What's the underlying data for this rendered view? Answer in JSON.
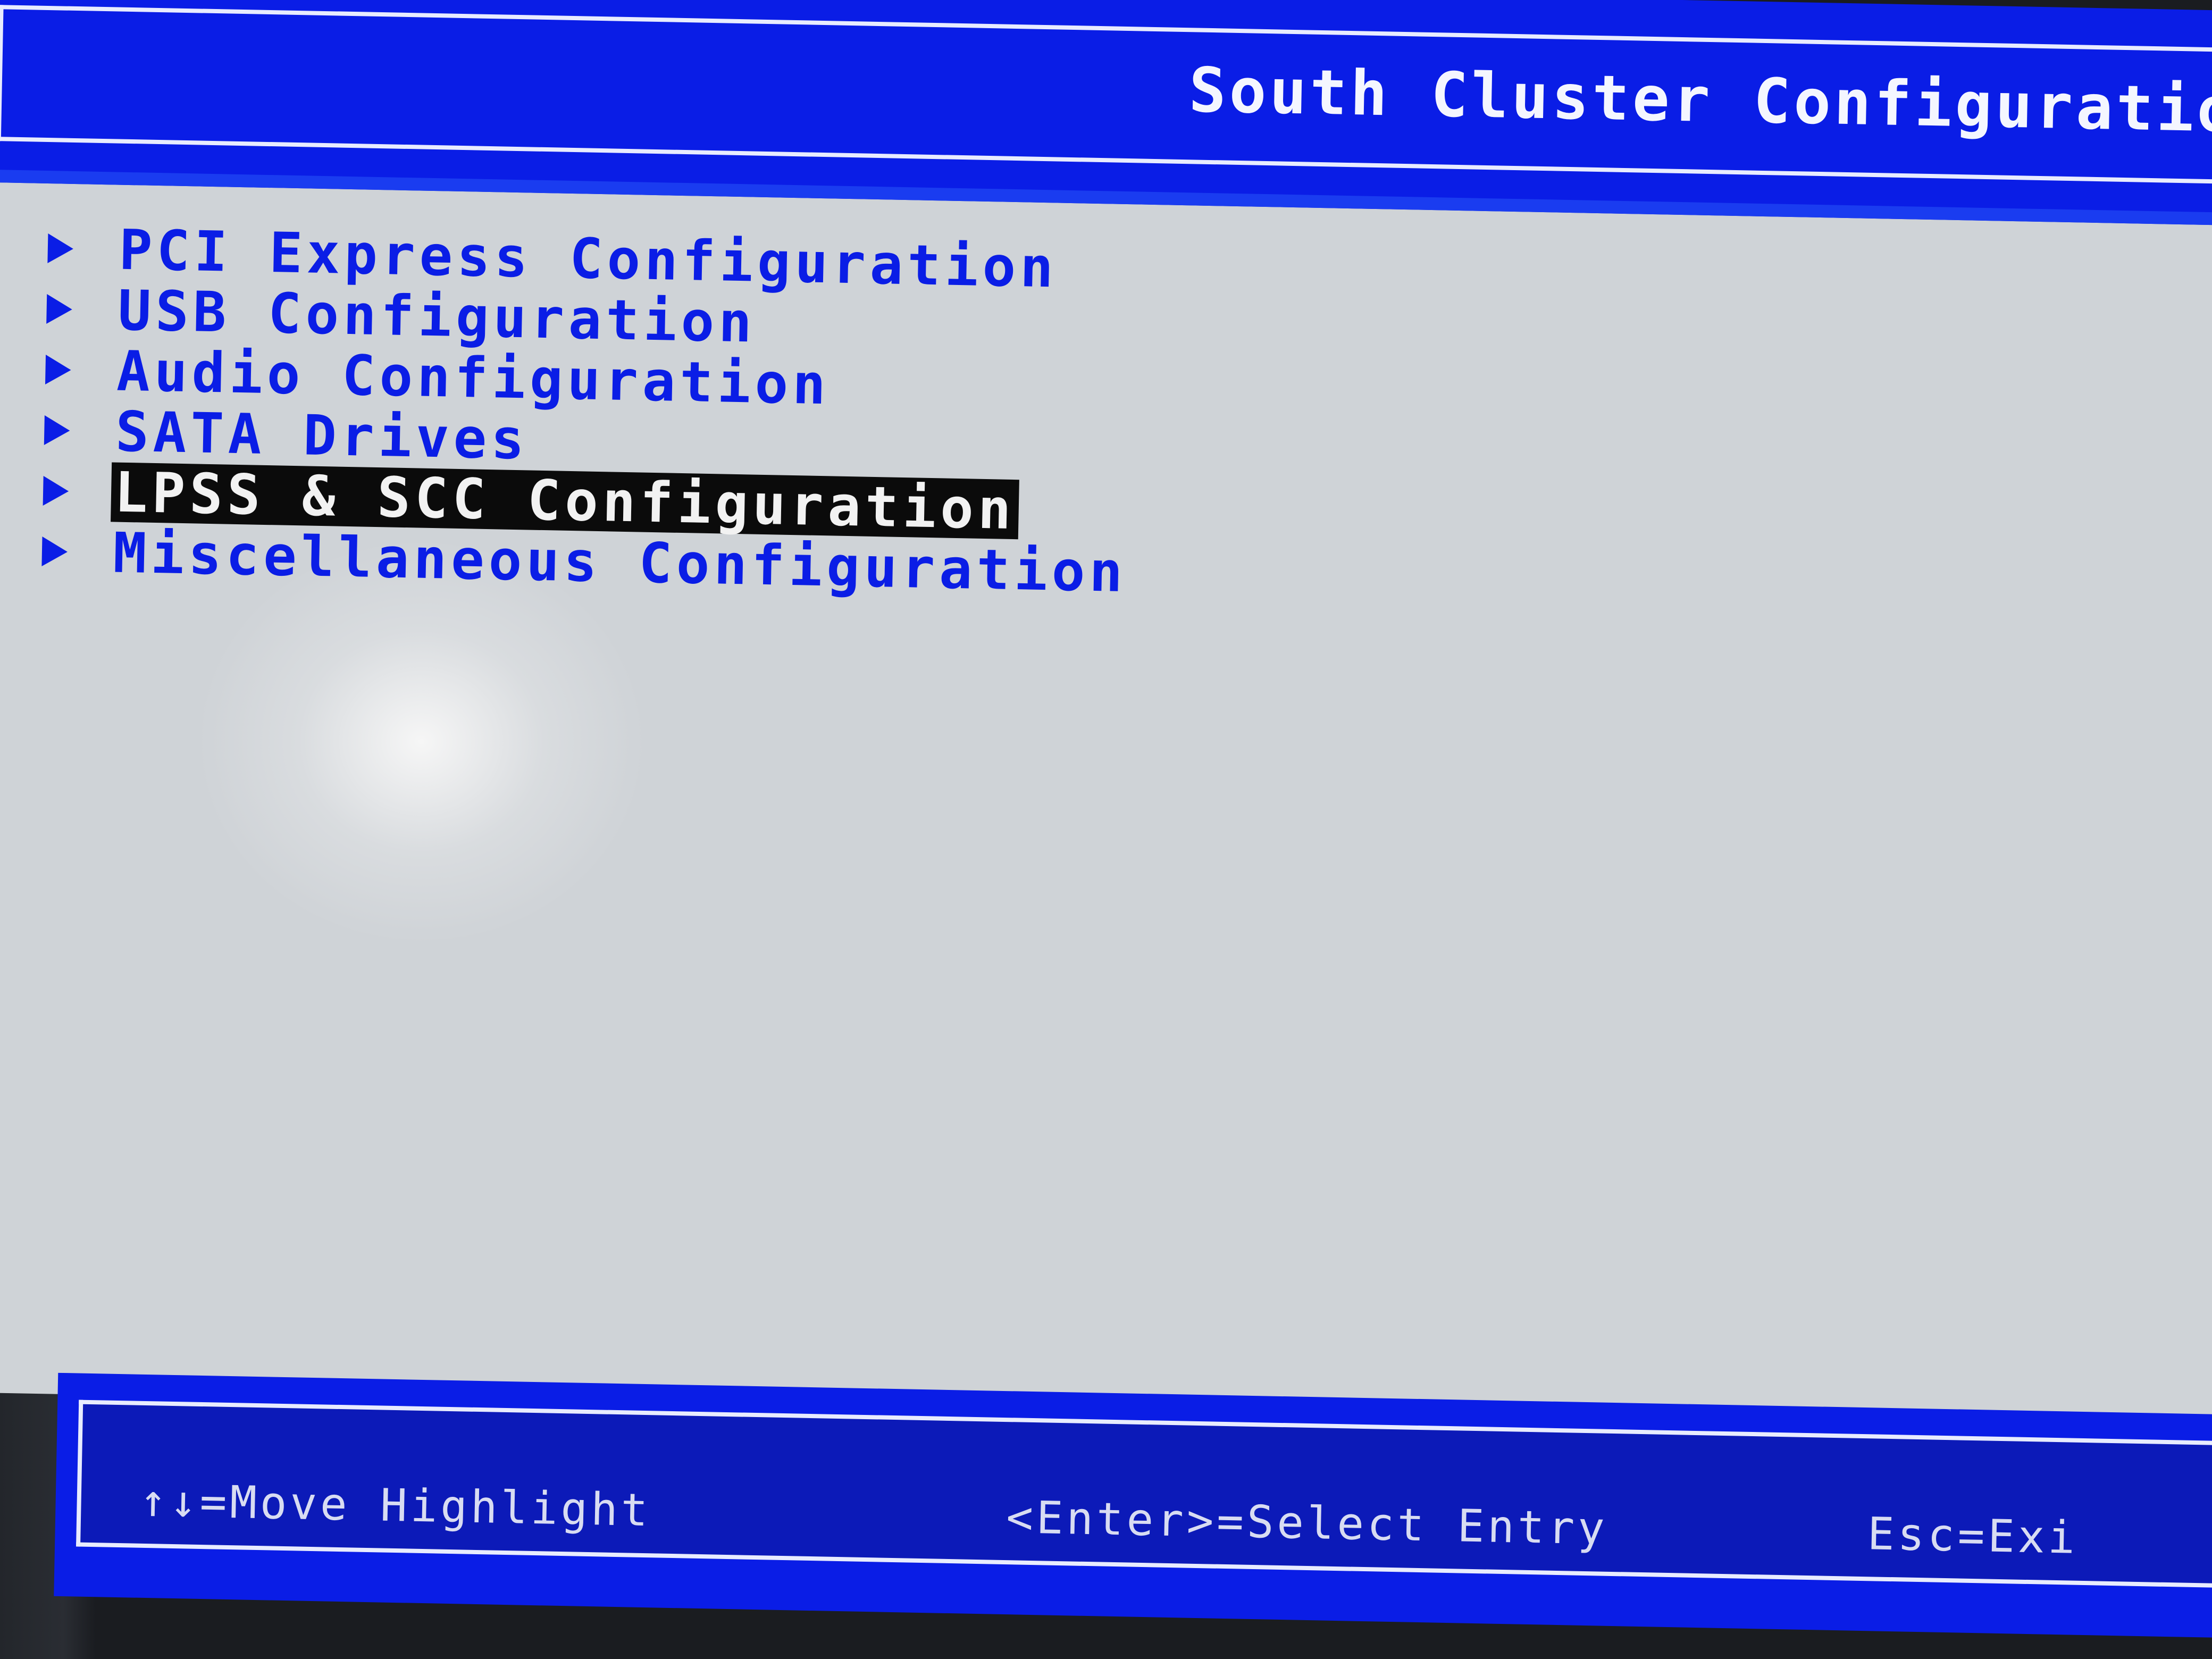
{
  "header": {
    "title": "South Cluster Configuration"
  },
  "menu": {
    "items": [
      {
        "label": "PCI Express Configuration",
        "selected": false
      },
      {
        "label": "USB Configuration",
        "selected": false
      },
      {
        "label": "Audio Configuration",
        "selected": false
      },
      {
        "label": "SATA Drives",
        "selected": false
      },
      {
        "label": "LPSS & SCC Configuration",
        "selected": true
      },
      {
        "label": "Miscellaneous Configuration",
        "selected": false
      }
    ]
  },
  "footer": {
    "move_hint": "↑↓=Move Highlight",
    "select_hint": "<Enter>=Select Entry",
    "exit_hint": "Esc=Exi"
  },
  "colors": {
    "bios_blue": "#0a1de6",
    "panel_gray": "#cfd3d7",
    "highlight_bg": "#0b0b0b",
    "highlight_fg": "#f2f2f2"
  },
  "icons": {
    "submenu": "triangle-right-icon"
  }
}
